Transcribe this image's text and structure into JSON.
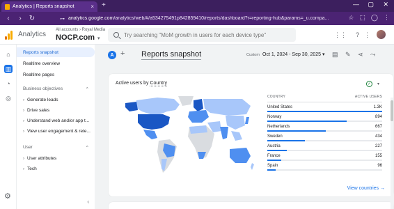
{
  "browser": {
    "tab_title": "Analytics | Reports snapshot",
    "tab_close": "×",
    "new_tab": "+",
    "url_host": "analytics.google.com",
    "url_rest": "/analytics/web/#/a534275491p842859410/reports/dashboard?r=reporting-hub&params=_u.compa...",
    "back": "‹",
    "forward": "›",
    "reload": "↻"
  },
  "header": {
    "app_name": "Analytics",
    "account_crumb": "All accounts › Royal Media",
    "account_name": "NOCP.com",
    "search_placeholder": "Try searching \"MoM growth in users for each device type\""
  },
  "nav": {
    "items": [
      {
        "label": "Reports snapshot",
        "active": true
      },
      {
        "label": "Realtime overview",
        "active": false
      },
      {
        "label": "Realtime pages",
        "active": false
      }
    ],
    "section_business": "Business objectives",
    "business_items": [
      "Generate leads",
      "Drive sales",
      "Understand web and/or app t...",
      "View user engagement & rete..."
    ],
    "section_user": "User",
    "user_items": [
      "User attributes",
      "Tech"
    ]
  },
  "report": {
    "avatar_letter": "A",
    "title": "Reports snapshot",
    "custom_label": "Custom",
    "date_range": "Oct 1, 2024 - Sep 30, 2025"
  },
  "card": {
    "metric": "Active users",
    "by": "by",
    "dimension": "Country",
    "col_country": "COUNTRY",
    "col_users": "ACTIVE USERS",
    "rows": [
      {
        "country": "United States",
        "value": "1.3K",
        "fraction": 1.0
      },
      {
        "country": "Norway",
        "value": "894",
        "fraction": 0.69
      },
      {
        "country": "Netherlands",
        "value": "667",
        "fraction": 0.51
      },
      {
        "country": "Sweden",
        "value": "434",
        "fraction": 0.33
      },
      {
        "country": "Austria",
        "value": "227",
        "fraction": 0.17
      },
      {
        "country": "France",
        "value": "155",
        "fraction": 0.12
      },
      {
        "country": "Spain",
        "value": "96",
        "fraction": 0.07
      }
    ],
    "view_link": "View countries →"
  },
  "colors": {
    "accent": "#1a73e8",
    "map_dark": "#1a57c4",
    "map_mid": "#4f8ff0",
    "map_light": "#a8c7fa",
    "map_none": "#d9dce0"
  }
}
